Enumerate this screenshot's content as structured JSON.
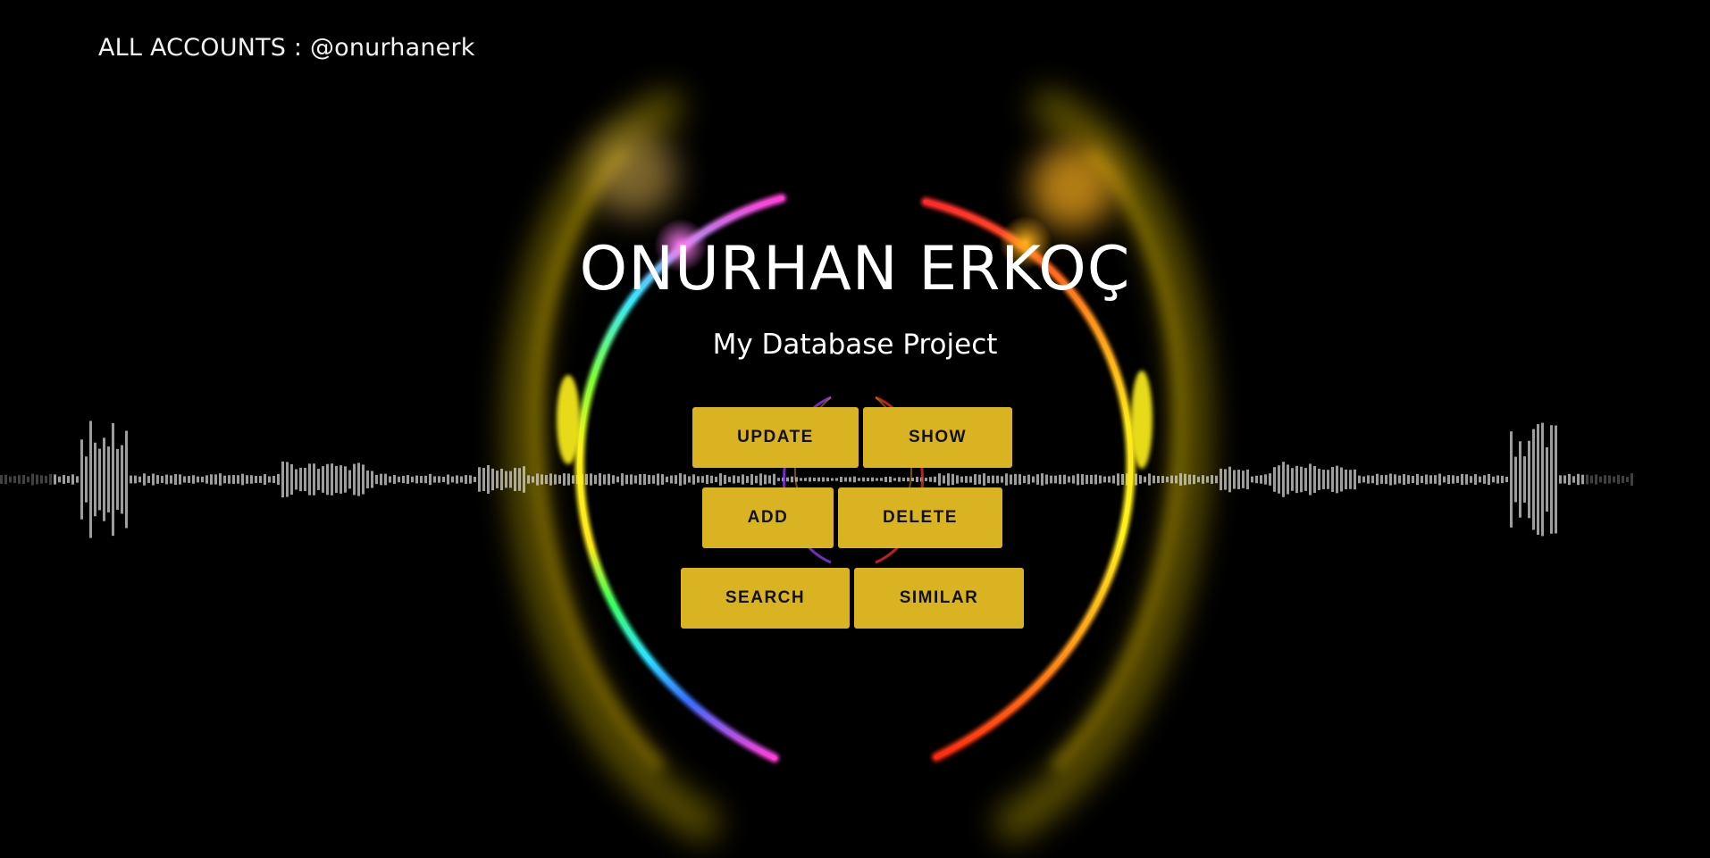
{
  "header": {
    "accounts_label": "ALL ACCOUNTS : @onurhanerk"
  },
  "hero": {
    "title": "ONURHAN ERKOÇ",
    "subtitle": "My Database Project"
  },
  "actions": {
    "update_label": "UPDATE",
    "show_label": "SHOW",
    "add_label": "ADD",
    "delete_label": "DELETE",
    "search_label": "SEARCH",
    "similar_label": "SIMILAR"
  },
  "colors": {
    "background": "#000000",
    "button": "#dab322",
    "button_text": "#111111",
    "text": "#ffffff"
  },
  "background_art": {
    "icon": "audio-visualizer-rings"
  }
}
